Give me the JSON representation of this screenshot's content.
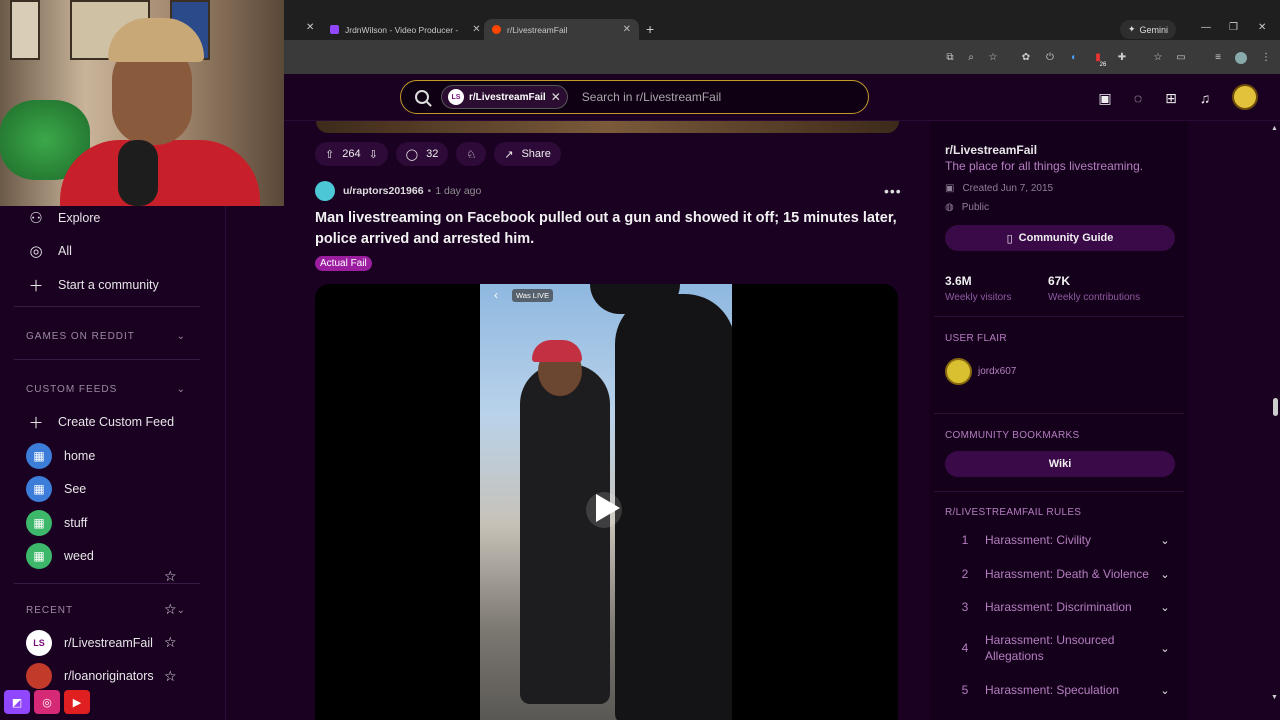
{
  "browser": {
    "tabs": [
      {
        "label": "JrdnWilson - Video Producer -",
        "fav_color": "#9146ff"
      },
      {
        "label": "r/LivestreamFail",
        "fav_color": "#ff4500"
      }
    ],
    "gemini_label": "Gemini",
    "notif_count": "26"
  },
  "reddit_header": {
    "chip_badge": "LS",
    "chip_label": "r/LivestreamFail",
    "search_placeholder": "Search in r/LivestreamFail"
  },
  "sidebar": {
    "nav": [
      {
        "label": "Explore",
        "icon": "explore-icon"
      },
      {
        "label": "All",
        "icon": "all-icon"
      },
      {
        "label": "Start a community",
        "icon": "plus-icon"
      }
    ],
    "games_heading": "GAMES ON REDDIT",
    "custom_feeds_heading": "CUSTOM FEEDS",
    "create_feed_label": "Create Custom Feed",
    "feeds": [
      {
        "label": "home",
        "color": "#3b7dd8"
      },
      {
        "label": "See",
        "color": "#3b7dd8"
      },
      {
        "label": "stuff",
        "color": "#3db86a"
      },
      {
        "label": "weed",
        "color": "#3db86a"
      }
    ],
    "recent_heading": "RECENT",
    "recent": [
      {
        "label": "r/LivestreamFail",
        "badge": "LS"
      },
      {
        "label": "r/loanoriginators",
        "badge": ""
      }
    ]
  },
  "post_actions": {
    "upvotes": "264",
    "comments": "32",
    "share_label": "Share"
  },
  "post": {
    "username": "u/raptors201966",
    "separator": "•",
    "time": "1 day ago",
    "title": "Man livestreaming on Facebook pulled out a gun and showed it off; 15 minutes later, police arrived and arrested him.",
    "flair": "Actual Fail",
    "live_tag": "Was LIVE"
  },
  "community": {
    "name": "r/LivestreamFail",
    "description": "The place for all things livestreaming.",
    "created": "Created Jun 7, 2015",
    "visibility": "Public",
    "guide_label": "Community Guide",
    "weekly_visitors": "3.6M",
    "weekly_visitors_label": "Weekly visitors",
    "weekly_contributions": "67K",
    "weekly_contributions_label": "Weekly contributions",
    "user_flair_heading": "USER FLAIR",
    "flair_user": "jordx607",
    "bookmarks_heading": "COMMUNITY BOOKMARKS",
    "wiki_label": "Wiki",
    "rules_heading": "R/LIVESTREAMFAIL RULES",
    "rules": [
      {
        "num": "1",
        "text": "Harassment: Civility"
      },
      {
        "num": "2",
        "text": "Harassment: Death & Violence"
      },
      {
        "num": "3",
        "text": "Harassment: Discrimination"
      },
      {
        "num": "4",
        "text": "Harassment: Unsourced Allegations"
      },
      {
        "num": "5",
        "text": "Harassment: Speculation"
      }
    ]
  }
}
